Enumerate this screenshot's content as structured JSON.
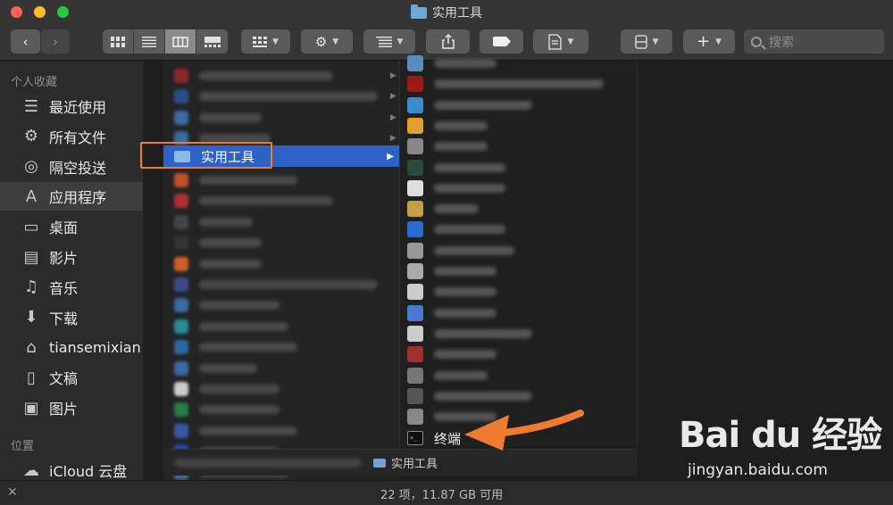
{
  "window": {
    "title": "实用工具"
  },
  "toolbar": {
    "back": "‹",
    "forward": "›",
    "share_icon": "share-icon",
    "search_placeholder": "搜索"
  },
  "sidebar": {
    "favorites_heading": "个人收藏",
    "items": [
      {
        "label": "最近使用",
        "icon": "recents-icon",
        "glyph": "☰"
      },
      {
        "label": "所有文件",
        "icon": "gear-icon",
        "glyph": "⚙"
      },
      {
        "label": "隔空投送",
        "icon": "airdrop-icon",
        "glyph": "◎"
      },
      {
        "label": "应用程序",
        "icon": "applications-icon",
        "glyph": "A"
      },
      {
        "label": "桌面",
        "icon": "desktop-icon",
        "glyph": "▭"
      },
      {
        "label": "影片",
        "icon": "movies-icon",
        "glyph": "▤"
      },
      {
        "label": "音乐",
        "icon": "music-icon",
        "glyph": "♫"
      },
      {
        "label": "下载",
        "icon": "downloads-icon",
        "glyph": "⬇"
      },
      {
        "label": "tiansemixian",
        "icon": "home-icon",
        "glyph": "⌂"
      },
      {
        "label": "文稿",
        "icon": "documents-icon",
        "glyph": "▯"
      },
      {
        "label": "图片",
        "icon": "pictures-icon",
        "glyph": "▣"
      }
    ],
    "locations_heading": "位置",
    "locations": [
      {
        "label": "iCloud 云盘",
        "icon": "cloud-icon",
        "glyph": "☁"
      }
    ]
  },
  "columns": {
    "selected_folder": "实用工具",
    "terminal_label": "终端"
  },
  "pathbar": {
    "current": "实用工具"
  },
  "status": {
    "text": "22 项，11.87 GB 可用"
  },
  "colors": {
    "accent": "#2e62c6",
    "annotation": "#f07a2e"
  },
  "watermark": {
    "logo": "Bai du 经验",
    "url": "jingyan.baidu.com"
  }
}
